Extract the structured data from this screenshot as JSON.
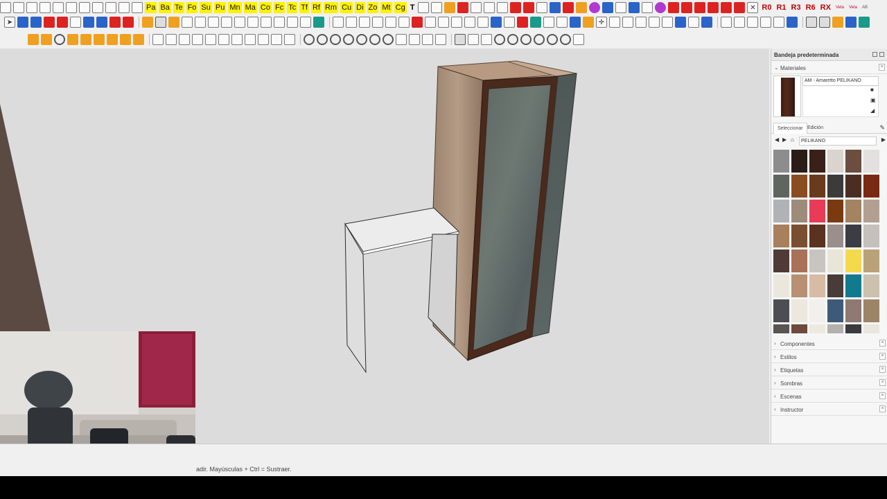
{
  "toolbar1": {
    "labels": [
      "Pa",
      "Ba",
      "Te",
      "Fo",
      "Su",
      "Pu",
      "Mn",
      "Ma",
      "Co",
      "Fc",
      "Tc",
      "Tf",
      "Rf",
      "Rm",
      "Cu",
      "Di",
      "Zo",
      "Mt",
      "Cg"
    ],
    "t_label": "T",
    "r_labels": [
      "R0",
      "R1",
      "R3",
      "R6",
      "RX"
    ],
    "tiny_labels": [
      "Veta",
      "Veta",
      "AB"
    ]
  },
  "viewport": {
    "description": ""
  },
  "status": {
    "text": "adir. Mayúsculas + Ctrl = Sustraer."
  },
  "tray": {
    "title": "Bandeja predeterminada",
    "materials_section": "Materiales",
    "material_name": "AM - Amaretto PELIKANO",
    "tab_select": "Seleccionar",
    "tab_edit": "Edición",
    "library": "PELIKANO",
    "swatches": [
      "#8d8d8d",
      "#2a1d17",
      "#3a2018",
      "#d9d4cd",
      "#6b4e3d",
      "#e3e1df",
      "#5f6660",
      "#8a4d22",
      "#6a3a1c",
      "#3b3b3b",
      "#4a2e22",
      "#7a2a14",
      "#b0b3b6",
      "#9d8c7a",
      "#ea3b56",
      "#7a3a10",
      "#a38360",
      "#b39f92",
      "#a8805c",
      "#7a4e30",
      "#5a3220",
      "#9a8f8a",
      "#3a3e44",
      "#c5c0bb",
      "#4f3a36",
      "#a87158",
      "#c8c5c0",
      "#e9e6d9",
      "#f4d94c",
      "#b9a178",
      "#ebe7dd",
      "#b89074",
      "#d7bba4",
      "#483c38",
      "#117a8e",
      "#cbc1ad",
      "#4c4e51",
      "#ece8de",
      "#f2f0ec",
      "#3e5a78",
      "#8e7a72",
      "#9c8466",
      "#5a5553",
      "#6e4a3a",
      "#eee9df",
      "#b3b1ad",
      "#3a3b3d",
      "#e9e6e0"
    ],
    "collapsed_sections": [
      "Componentes",
      "Estilos",
      "Etiquetas",
      "Sombras",
      "Escenas",
      "Instructor"
    ]
  }
}
